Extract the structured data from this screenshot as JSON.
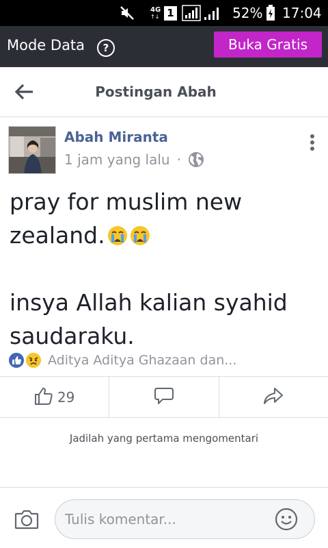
{
  "status_bar": {
    "network_type": "4G",
    "sim_slot": "1",
    "battery_percent": "52%",
    "time": "17:04",
    "icons": [
      "mute-icon",
      "signal-icon",
      "battery-icon"
    ]
  },
  "mode_bar": {
    "label": "Mode Data",
    "help_icon": "?",
    "cta_label": "Buka Gratis",
    "cta_color": "#c225c8"
  },
  "header": {
    "title": "Postingan Abah"
  },
  "post": {
    "author": "Abah Miranta",
    "time": "1 jam yang lalu",
    "separator": "·",
    "privacy_icon": "globe-icon",
    "text_lines": [
      "pray for muslim new zealand.",
      "insya Allah kalian syahid saudaraku."
    ],
    "emojis": [
      "crying-face-icon",
      "crying-face-icon"
    ],
    "reactions_icons": [
      "like-reaction-icon",
      "sad-reaction-icon"
    ],
    "reactions_text": "Aditya Aditya Ghazaan dan..."
  },
  "actions": {
    "like_count": "29"
  },
  "comments": {
    "empty_text": "Jadilah yang pertama mengomentari"
  },
  "composer": {
    "placeholder": "Tulis komentar..."
  },
  "colors": {
    "link_blue": "#4b6394",
    "facebook_blue": "#4267b2",
    "muted": "#90949c",
    "divider": "#dadde1",
    "status_bg": "#000000",
    "mode_bar_bg": "#2b2f35"
  }
}
